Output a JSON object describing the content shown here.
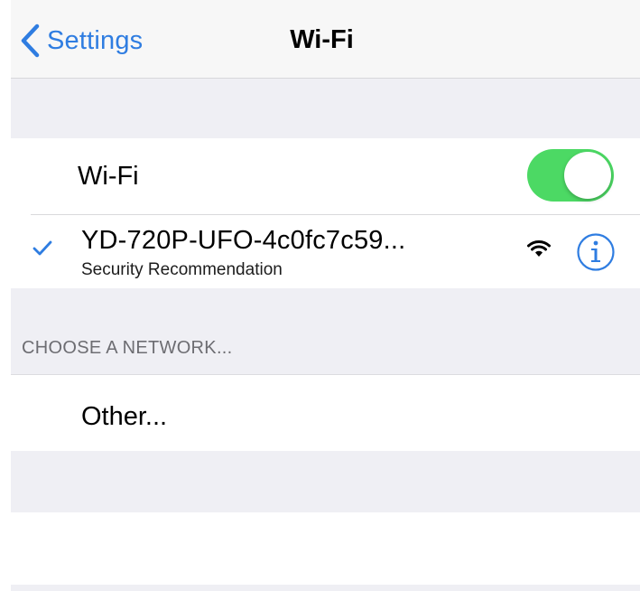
{
  "navbar": {
    "back_label": "Settings",
    "title": "Wi-Fi",
    "back_icon": "chevron-left-icon"
  },
  "wifi_toggle": {
    "label": "Wi-Fi",
    "state": "on",
    "color": "#4cd964"
  },
  "connected_network": {
    "name": "YD-720P-UFO-4c0fc7c59...",
    "subtitle": "Security Recommendation",
    "check_icon": "checkmark-icon",
    "signal_icon": "wifi-signal-icon",
    "info_icon": "info-icon"
  },
  "networks_section": {
    "header": "CHOOSE A NETWORK...",
    "other_label": "Other..."
  },
  "colors": {
    "accent": "#2f7de1",
    "toggle_on": "#4cd964",
    "grouped_background": "#efeff4",
    "section_header": "#6d6d72"
  }
}
